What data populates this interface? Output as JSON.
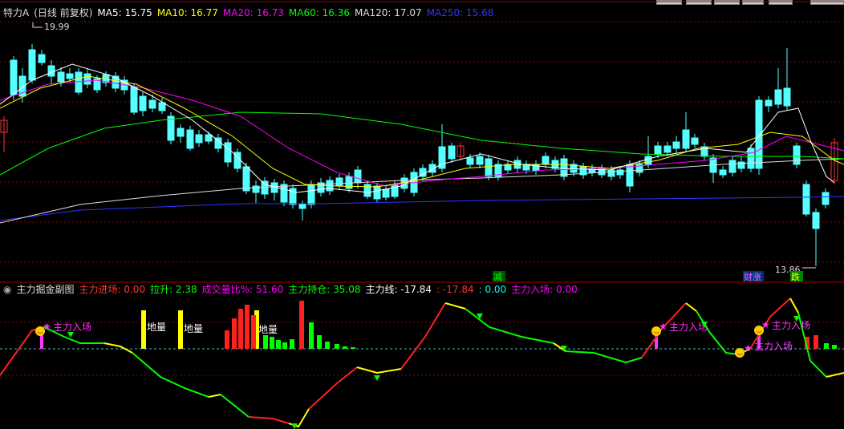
{
  "main_header": {
    "stock": "特力A",
    "mode": "(日线 前复权)",
    "ma": [
      {
        "label": "MA5: 15.75",
        "color": "#ffffff"
      },
      {
        "label": "MA10: 16.77",
        "color": "#ffff00"
      },
      {
        "label": "MA20: 16.73",
        "color": "#ff00ff"
      },
      {
        "label": "MA60: 16.36",
        "color": "#00ff00"
      },
      {
        "label": "MA120: 17.07",
        "color": "#dddddd"
      },
      {
        "label": "MA250: 15.68",
        "color": "#3333ff"
      }
    ]
  },
  "sub_header": {
    "name": "主力掘金副图",
    "items": [
      {
        "label": "主力进场: 0.00",
        "color": "#ff3333"
      },
      {
        "label": "拉升: 2.38",
        "color": "#00ff00"
      },
      {
        "label": "成交量比%: 51.60",
        "color": "#ff00ff"
      },
      {
        "label": "主力持仓: 35.08",
        "color": "#00ff00"
      },
      {
        "label": "主力线: -17.84",
        "color": "#ffffff"
      },
      {
        "label": ": -17.84",
        "color": "#ff3333"
      },
      {
        "label": ": 0.00",
        "color": "#00ffff"
      },
      {
        "label": "主力入场: 0.00",
        "color": "#ff00ff"
      }
    ]
  },
  "annotations": {
    "high_price": "19.99",
    "low_price": "13.86",
    "sig_jian": "减",
    "sig_caizhang": "财涨",
    "sig_die": "跌",
    "dilian": "地量",
    "zhuli_ruchang": "主力入场"
  },
  "colors": {
    "up": "#ff3232",
    "down": "#54ffff",
    "grid": "#8b0000",
    "ma5": "#ffffff",
    "ma10": "#ffff00",
    "ma20": "#ff00ff",
    "ma60": "#00ff00",
    "ma120": "#dddddd",
    "ma250": "#3333ff"
  }
}
